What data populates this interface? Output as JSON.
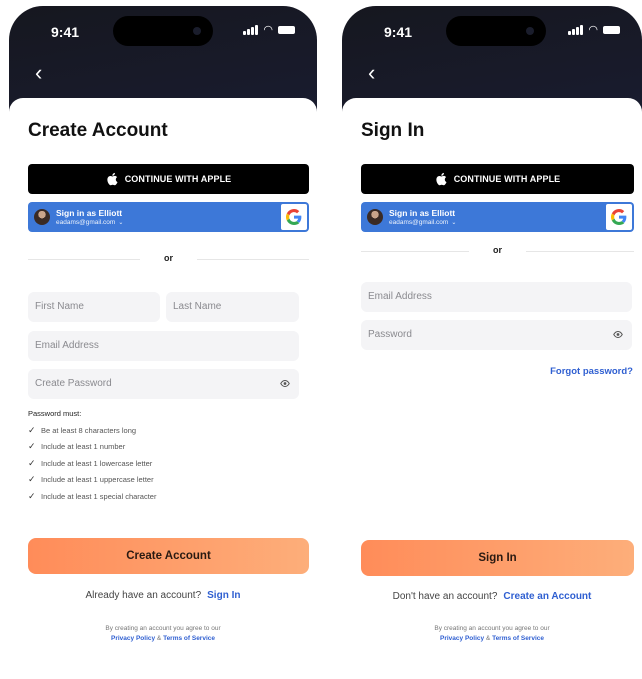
{
  "status": {
    "time": "9:41"
  },
  "create_screen": {
    "title": "Create Account",
    "apple_label": "CONTINUE WITH APPLE",
    "google_name": "Sign in as Elliott",
    "google_email": "eadams@gmail.com",
    "or_label": "or",
    "first_name_placeholder": "First Name",
    "last_name_placeholder": "Last Name",
    "email_placeholder": "Email Address",
    "password_placeholder": "Create Password",
    "rules_title": "Password must:",
    "rules": [
      "Be at least 8 characters long",
      "Include at least 1 number",
      "Include at least 1 lowercase letter",
      "Include at least 1 uppercase letter",
      "Include at least 1 special character"
    ],
    "primary_label": "Create Account",
    "switch_prompt": "Already have an account?",
    "switch_link": "Sign In",
    "legal_line": "By creating an account you agree to our",
    "privacy": "Privacy Policy",
    "amp": "&",
    "terms": "Terms of Service"
  },
  "signin_screen": {
    "title": "Sign In",
    "apple_label": "CONTINUE WITH APPLE",
    "google_name": "Sign in as Elliott",
    "google_email": "eadams@gmail.com",
    "or_label": "or",
    "email_placeholder": "Email Address",
    "password_placeholder": "Password",
    "forgot_label": "Forgot password?",
    "primary_label": "Sign In",
    "switch_prompt": "Don't have an account?",
    "switch_link": "Create an Account",
    "legal_line": "By creating an account you agree to our",
    "privacy": "Privacy Policy",
    "amp": "&",
    "terms": "Terms of Service"
  },
  "colors": {
    "accent_blue": "#2f5fd1",
    "google_blue": "#3d78d8",
    "button_orange": "#ff8c59"
  },
  "icons": [
    "back-chevron-icon",
    "apple-icon",
    "google-icon",
    "avatar",
    "chevron-down-icon",
    "eye-icon",
    "check-icon",
    "signal-icon",
    "wifi-icon",
    "battery-icon"
  ]
}
